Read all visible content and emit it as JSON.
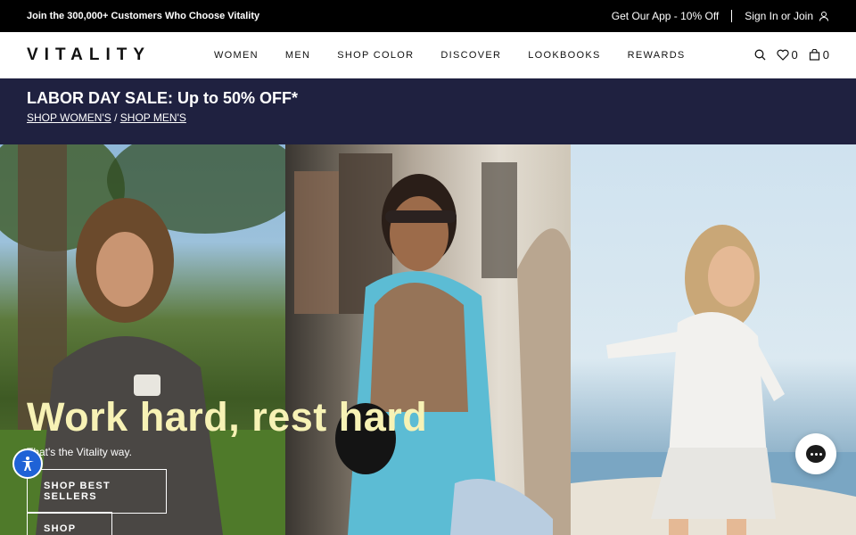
{
  "topbar": {
    "promo_text": "Join the 300,000+ Customers Who Choose Vitality",
    "app_link": "Get Our App - 10% Off",
    "signin_link": "Sign In or Join",
    "user_icon": "user-icon"
  },
  "nav": {
    "logo_text": "VITALITY",
    "menu": [
      "WOMEN",
      "MEN",
      "SHOP COLOR",
      "DISCOVER",
      "LOOKBOOKS",
      "REWARDS"
    ],
    "icons": {
      "search": "search-icon",
      "wishlist": "heart-icon",
      "cart": "bag-icon"
    },
    "wishlist_count": "0",
    "cart_count": "0"
  },
  "promo": {
    "title": "LABOR DAY SALE: Up to 50% OFF*",
    "shop_womens": "SHOP WOMEN'S",
    "separator": "/",
    "shop_mens": "SHOP MEN'S",
    "background_color": "#1f2140"
  },
  "hero": {
    "headline": "Work hard, rest hard",
    "subtext": "That's the Vitality way.",
    "primary_button": "SHOP BEST SELLERS",
    "secondary_button": "SHOP ALL",
    "headline_color": "#f7f2b5"
  },
  "widgets": {
    "accessibility_icon": "accessibility-icon",
    "chat_icon": "chat-icon",
    "accessibility_color": "#1f62d6"
  }
}
